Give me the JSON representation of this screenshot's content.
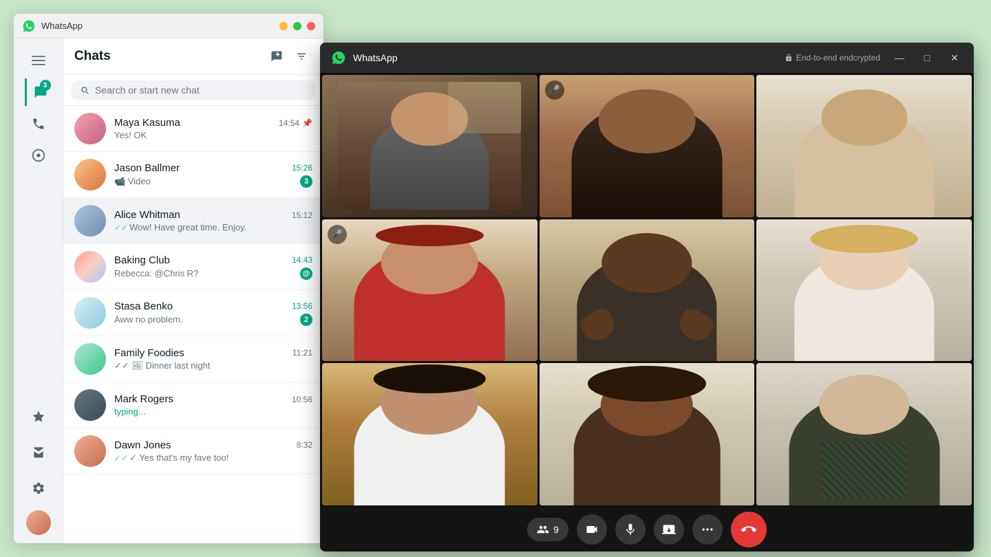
{
  "app": {
    "title": "WhatsApp",
    "encryption_label": "End-to-end endcrypted"
  },
  "sidebar": {
    "chat_badge": "3",
    "icons": [
      {
        "name": "menu-icon",
        "symbol": "☰",
        "active": false
      },
      {
        "name": "chats-icon",
        "symbol": "💬",
        "active": true
      },
      {
        "name": "calls-icon",
        "symbol": "📞",
        "active": false
      },
      {
        "name": "status-icon",
        "symbol": "◎",
        "active": false
      },
      {
        "name": "starred-icon",
        "symbol": "★",
        "active": false
      },
      {
        "name": "archive-icon",
        "symbol": "⊞",
        "active": false
      },
      {
        "name": "settings-icon",
        "symbol": "⚙",
        "active": false
      }
    ]
  },
  "chat_panel": {
    "title": "Chats",
    "new_chat_label": "✏",
    "filter_label": "☰",
    "search_placeholder": "Search or start new chat"
  },
  "chats": [
    {
      "id": "maya",
      "name": "Maya Kasuma",
      "time": "14:54",
      "preview": "Yes! OK",
      "unread": 0,
      "pinned": true,
      "avatar_class": "av-maya",
      "avatar_emoji": ""
    },
    {
      "id": "jason",
      "name": "Jason Ballmer",
      "time": "15:26",
      "preview": "📹 Video",
      "unread": 3,
      "pinned": false,
      "time_class": "unread",
      "avatar_class": "av-jason",
      "avatar_emoji": ""
    },
    {
      "id": "alice",
      "name": "Alice Whitman",
      "time": "15:12",
      "preview": "Wow! Have great time. Enjoy.",
      "unread": 0,
      "active": true,
      "pinned": false,
      "avatar_class": "av-alice",
      "avatar_emoji": ""
    },
    {
      "id": "baking",
      "name": "Baking Club",
      "time": "14:43",
      "preview": "Rebecca: @Chris R?",
      "unread": 1,
      "mention": true,
      "time_class": "unread",
      "avatar_class": "av-baking",
      "avatar_emoji": ""
    },
    {
      "id": "stasa",
      "name": "Stasa Benko",
      "time": "13:56",
      "preview": "Aww no problem.",
      "unread": 2,
      "time_class": "unread",
      "avatar_class": "av-stasa",
      "avatar_emoji": ""
    },
    {
      "id": "family",
      "name": "Family Foodies",
      "time": "11:21",
      "preview": "✓✓ 🖼 Dinner last night",
      "unread": 0,
      "pinned": false,
      "avatar_class": "av-family",
      "avatar_emoji": ""
    },
    {
      "id": "mark",
      "name": "Mark Rogers",
      "time": "10:56",
      "preview": "typing...",
      "preview_class": "typing",
      "unread": 0,
      "avatar_class": "av-mark",
      "avatar_emoji": ""
    },
    {
      "id": "dawn",
      "name": "Dawn Jones",
      "time": "8:32",
      "preview": "✓ Yes that's my fave too!",
      "unread": 0,
      "avatar_class": "av-dawn",
      "avatar_emoji": ""
    }
  ],
  "call_controls": {
    "participants_count": "9",
    "participants_icon": "👥",
    "video_icon": "🎥",
    "mic_icon": "🎙",
    "screen_icon": "⊡",
    "more_icon": "•••",
    "end_icon": "📵"
  },
  "window_controls": {
    "minimize": "—",
    "maximize": "□",
    "close": "✕"
  }
}
